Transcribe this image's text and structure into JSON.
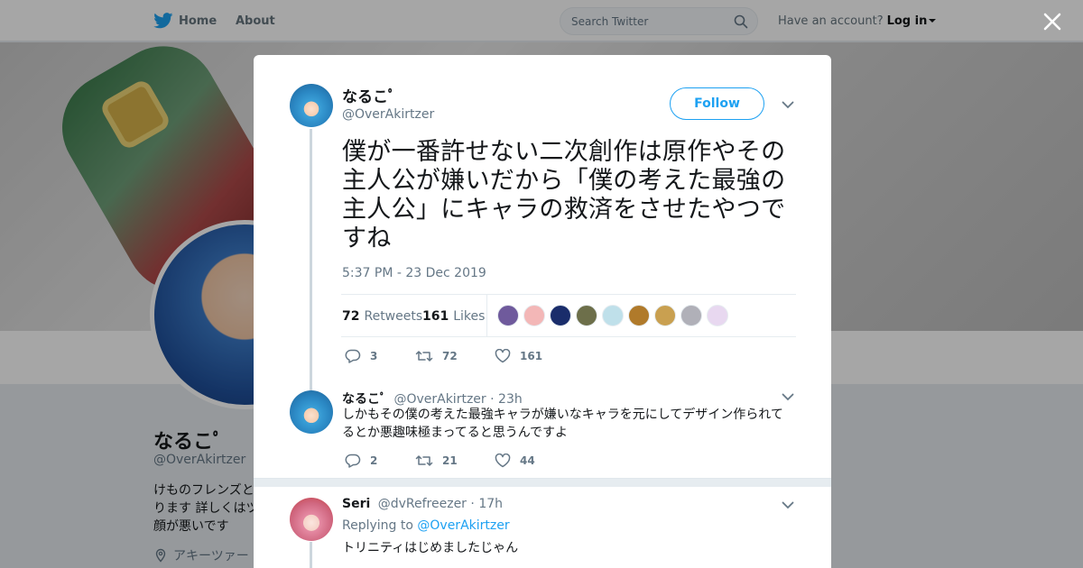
{
  "topbar": {
    "home_label": "Home",
    "about_label": "About",
    "search_placeholder": "Search Twitter",
    "account_prompt": "Have an account?",
    "login_label": "Log in"
  },
  "profile": {
    "name": "なるこﾟ",
    "handle": "@OverAkirtzer",
    "bio": "けものフレンズと\nります 詳しくはツ\n顔が悪いです",
    "location": "アキーツァー"
  },
  "tweet": {
    "author_name": "なるこﾟ",
    "author_handle": "@OverAkirtzer",
    "follow_label": "Follow",
    "text": "僕が一番許せない二次創作は原作やその主人公が嫌いだから「僕の考えた最強の主人公」にキャラの救済をさせたやつですね",
    "timestamp": "5:37 PM - 23 Dec 2019",
    "retweets_count": "72",
    "retweets_label": "Retweets",
    "likes_count": "161",
    "likes_label": "Likes",
    "liker_colors": [
      "#6f5a9c",
      "#f3b7b7",
      "#1a2d6b",
      "#6d6f4a",
      "#bfe0ea",
      "#b07a2a",
      "#c9a050",
      "#b0b0b8",
      "#e8d8f0"
    ],
    "actions": {
      "replies": "3",
      "retweets": "72",
      "likes": "161"
    }
  },
  "replies": [
    {
      "name": "なるこﾟ",
      "handle": "@OverAkirtzer",
      "time": "23h",
      "text": "しかもその僕の考えた最強キャラが嫌いなキャラを元にしてデザイン作られてるとか悪趣味極まってると思うんですよ",
      "actions": {
        "replies": "2",
        "retweets": "21",
        "likes": "44"
      }
    },
    {
      "name": "Seri",
      "handle": "@dvRefreezer",
      "time": "17h",
      "replying_prefix": "Replying to",
      "replying_to": "@OverAkirtzer",
      "text": "トリニティはじめましたじゃん"
    }
  ],
  "colors": {
    "accent": "#1da1f2",
    "text": "#14171a",
    "muted": "#657786",
    "thread_line": "#ccd6dd"
  },
  "icons": {
    "brand": "twitter-bird-icon",
    "search": "search-icon",
    "close": "close-icon",
    "more": "chevron-down-icon",
    "reply": "reply-icon",
    "retweet": "retweet-icon",
    "like": "heart-icon",
    "location": "location-icon"
  }
}
